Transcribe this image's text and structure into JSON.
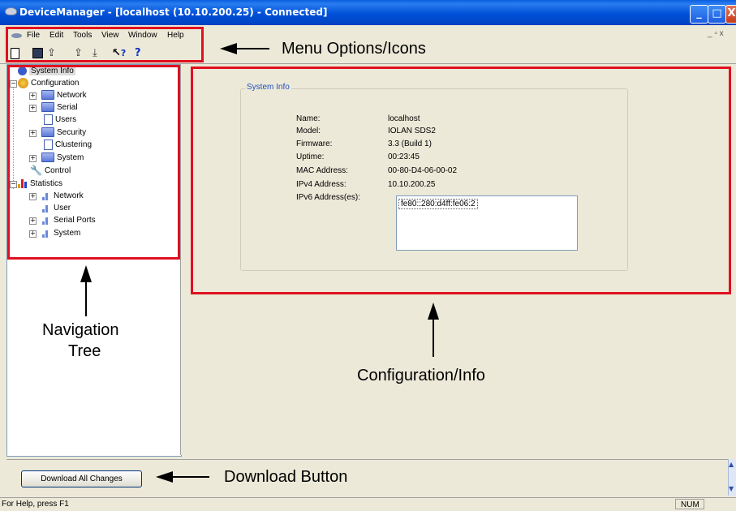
{
  "window": {
    "title": "DeviceManager - [localhost (10.10.200.25) - Connected]",
    "minimize_glyph": "_",
    "restore_glyph": "□",
    "close_glyph": "X"
  },
  "menu": {
    "items": [
      "File",
      "Edit",
      "Tools",
      "View",
      "Window",
      "Help"
    ],
    "mdi_controls": "_ ▫ x"
  },
  "toolbar": {
    "icons": [
      "new-icon",
      "save-icon",
      "upload-icon",
      "upload-to-icon",
      "download-icon",
      "whats-this-help-icon",
      "help-icon"
    ],
    "help_glyph": "?",
    "whats_this_glyph": "?"
  },
  "tree": {
    "system_info": "System Info",
    "configuration": "Configuration",
    "network": "Network",
    "serial": "Serial",
    "users": "Users",
    "security": "Security",
    "clustering": "Clustering",
    "system": "System",
    "control": "Control",
    "statistics": "Statistics",
    "stat_network": "Network",
    "stat_user": "User",
    "stat_serial_ports": "Serial Ports",
    "stat_system": "System"
  },
  "system_info": {
    "group_title": "System Info",
    "fields": [
      {
        "label": "Name:",
        "value": "localhost"
      },
      {
        "label": "Model:",
        "value": "IOLAN SDS2"
      },
      {
        "label": "Firmware:",
        "value": "3.3 (Build 1)"
      },
      {
        "label": "Uptime:",
        "value": "00:23:45"
      },
      {
        "label": "MAC Address:",
        "value": "00-80-D4-06-00-02"
      },
      {
        "label": "IPv4 Address:",
        "value": "10.10.200.25"
      }
    ],
    "ipv6_label": "IPv6 Address(es):",
    "ipv6_value": "fe80::280:d4ff:fe06:2"
  },
  "annotations": {
    "menu": "Menu Options/Icons",
    "nav_line1": "Navigation",
    "nav_line2": "Tree",
    "config": "Configuration/Info",
    "download": "Download Button",
    "color": "#e01020"
  },
  "bottom": {
    "download_label": "Download All Changes"
  },
  "status": {
    "text": "For Help, press F1",
    "num": "NUM"
  }
}
